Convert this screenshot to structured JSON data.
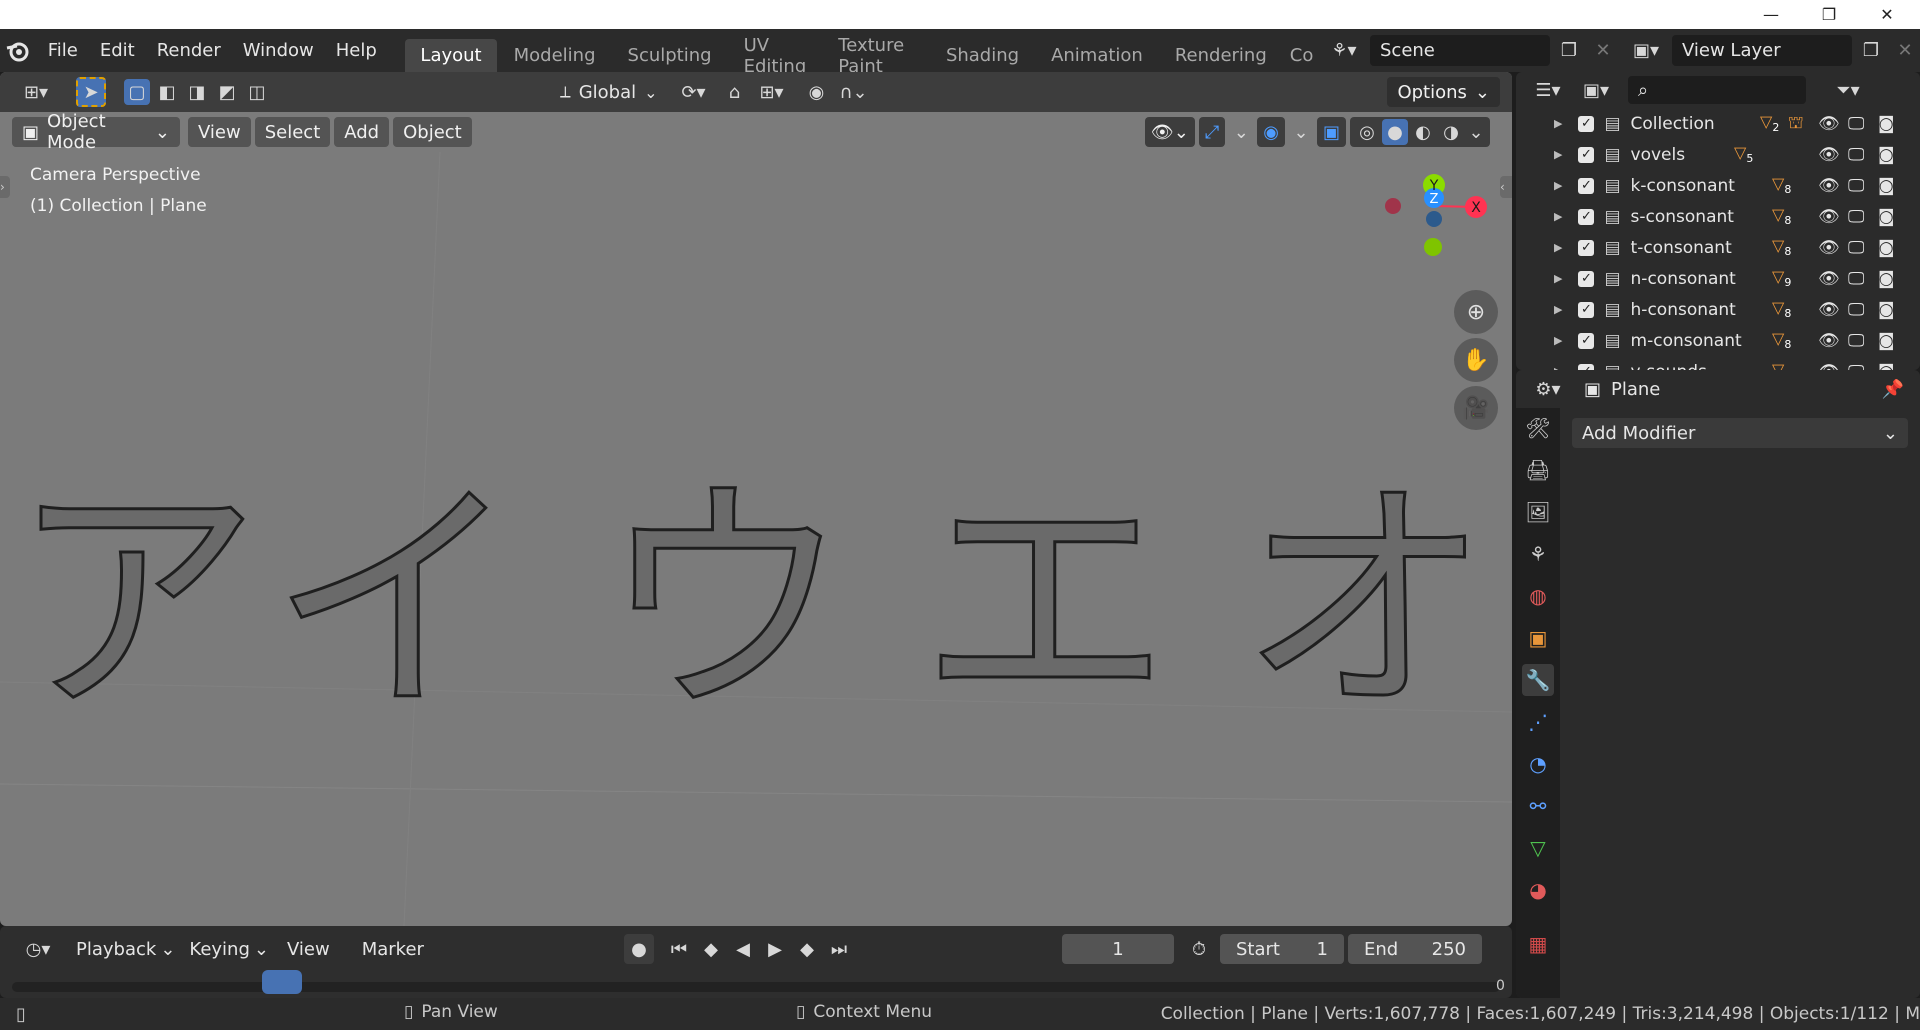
{
  "os_window": {
    "minimize": "—",
    "restore": "❐",
    "close": "✕"
  },
  "menu": [
    "File",
    "Edit",
    "Render",
    "Window",
    "Help"
  ],
  "workspaces": [
    "Layout",
    "Modeling",
    "Sculpting",
    "UV Editing",
    "Texture Paint",
    "Shading",
    "Animation",
    "Rendering",
    "Co"
  ],
  "active_workspace": "Layout",
  "scene": "Scene",
  "view_layer": "View Layer",
  "viewport": {
    "transform_orientation": "Global",
    "options_label": "Options",
    "mode": "Object Mode",
    "menus": [
      "View",
      "Select",
      "Add",
      "Object"
    ],
    "overlay_line1": "Camera Perspective",
    "overlay_line2": "(1) Collection | Plane",
    "gizmo": {
      "x": "X",
      "y": "Y",
      "z": "Z"
    },
    "katakana": [
      "ア",
      "イ",
      "ウ",
      "エ",
      "オ"
    ]
  },
  "outliner": {
    "rows": [
      {
        "name": "Collection",
        "count": "2"
      },
      {
        "name": "vovels",
        "count": "5"
      },
      {
        "name": "k-consonant",
        "count": "8"
      },
      {
        "name": "s-consonant",
        "count": "8"
      },
      {
        "name": "t-consonant",
        "count": "8"
      },
      {
        "name": "n-consonant",
        "count": "9"
      },
      {
        "name": "h-consonant",
        "count": "8"
      },
      {
        "name": "m-consonant",
        "count": "8"
      },
      {
        "name": "y-sounds",
        "count": ""
      }
    ]
  },
  "properties": {
    "object_name": "Plane",
    "add_modifier": "Add Modifier"
  },
  "timeline": {
    "menus": [
      "Playback",
      "Keying",
      "View",
      "Marker"
    ],
    "current_frame": "1",
    "start_label": "Start",
    "start_value": "1",
    "end_label": "End",
    "end_value": "250",
    "ruler_end": "0"
  },
  "status": {
    "pan_view": "Pan View",
    "context_menu": "Context Menu",
    "stats": "Collection | Plane | Verts:1,607,778 | Faces:1,607,249 | Tris:3,214,498 | Objects:1/112 | M"
  },
  "colors": {
    "accent_blue": "#4772b3",
    "axis_x": "#ff3352",
    "axis_y": "#8bdc00",
    "axis_z": "#2890ff",
    "mesh_count_orange": "#e8963a"
  }
}
